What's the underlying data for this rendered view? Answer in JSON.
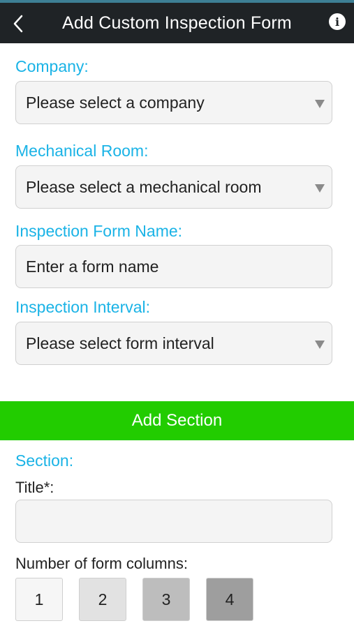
{
  "header": {
    "title": "Add Custom Inspection Form",
    "back_icon": "chevron-left-icon",
    "info_icon": "info-icon",
    "info_glyph": "i"
  },
  "form": {
    "company": {
      "label": "Company:",
      "value": "Please select a company"
    },
    "mechanical_room": {
      "label": "Mechanical Room:",
      "value": "Please select a mechanical room"
    },
    "form_name": {
      "label": "Inspection Form Name:",
      "placeholder": "Enter a form name"
    },
    "interval": {
      "label": "Inspection Interval:",
      "value": "Please select form interval"
    }
  },
  "add_section_button": "Add Section",
  "section": {
    "heading": "Section:",
    "title_label": "Title*:",
    "title_value": "",
    "columns_label": "Number of form columns:",
    "column_options": [
      "1",
      "2",
      "3",
      "4"
    ]
  },
  "colors": {
    "accent_blue": "#1ab3e6",
    "header_bg": "#1f2326",
    "add_section_green": "#22cc00",
    "column_shades": [
      "#f6f6f6",
      "#e2e2e2",
      "#bdbdbd",
      "#9e9e9e"
    ]
  }
}
